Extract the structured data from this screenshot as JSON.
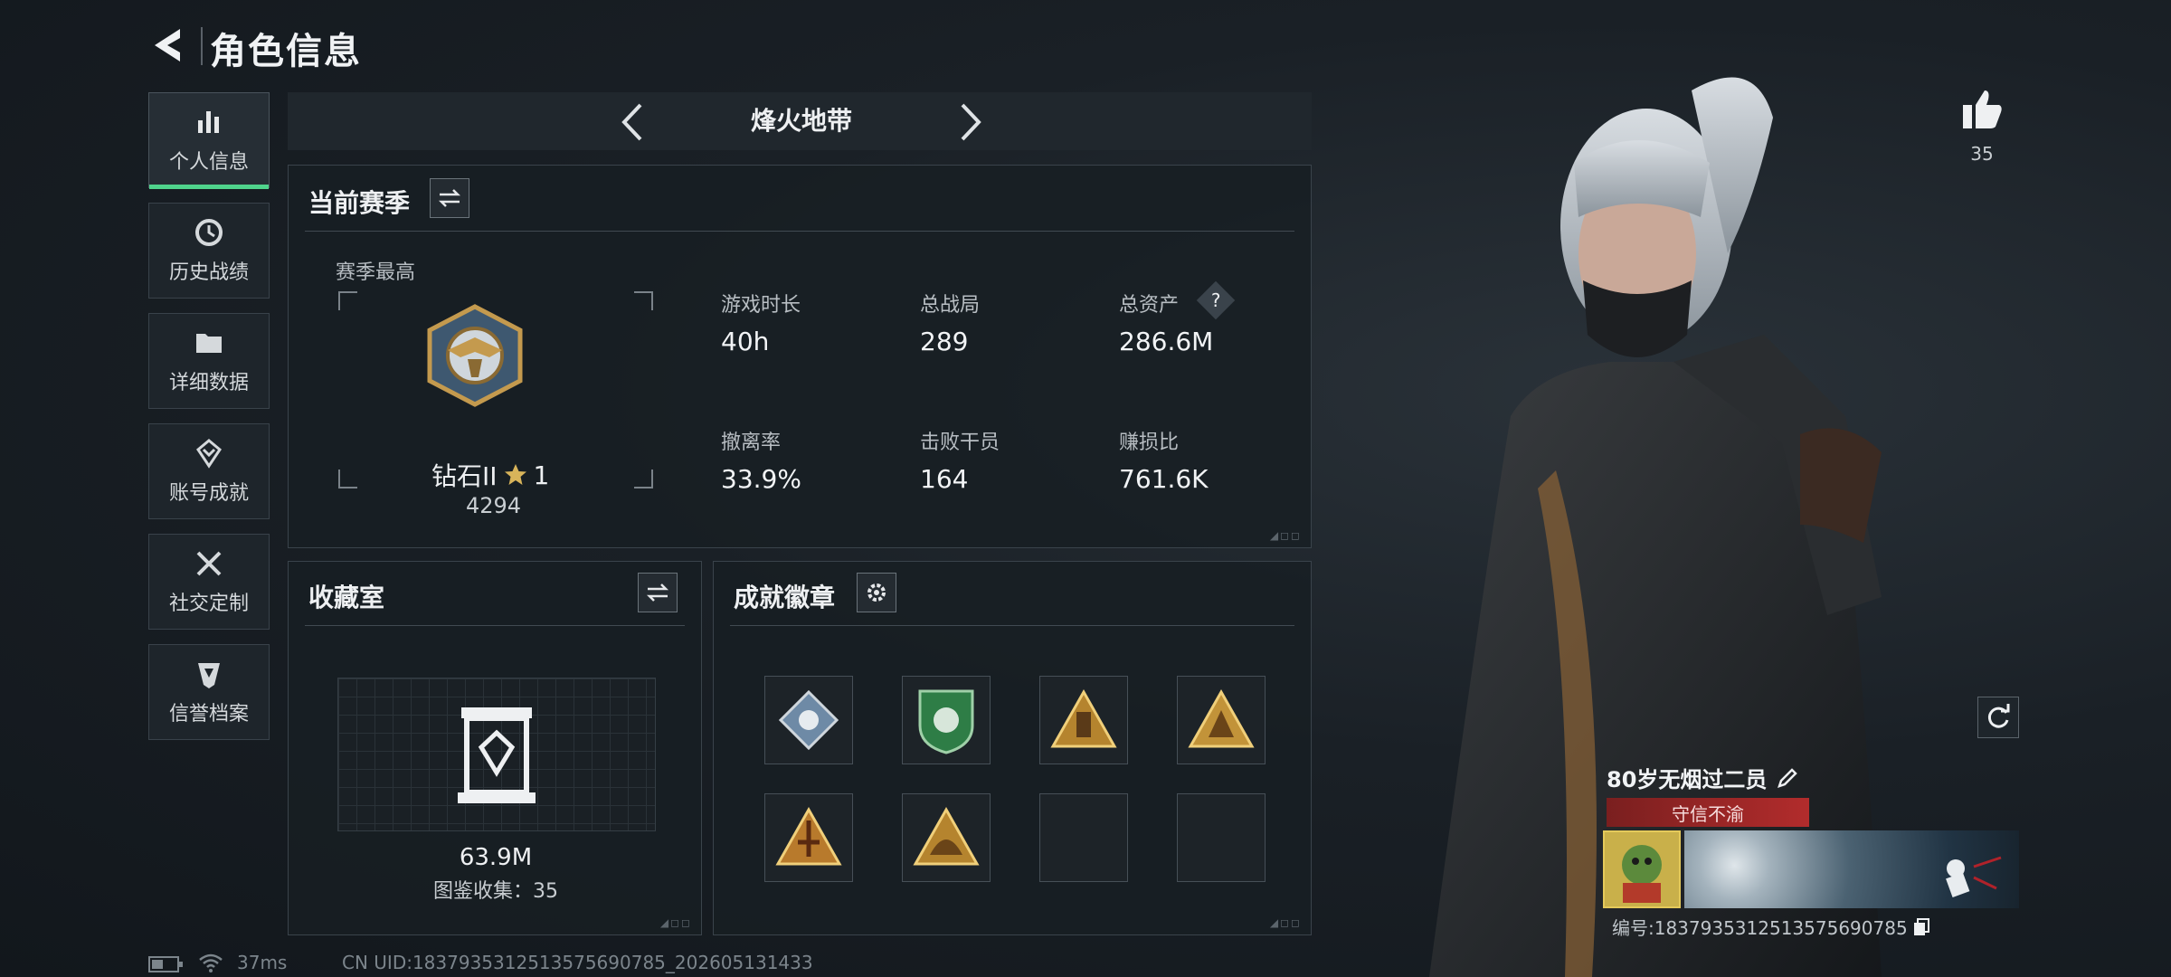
{
  "header": {
    "title": "角色信息"
  },
  "sidebar": {
    "items": [
      {
        "label": "个人信息",
        "icon": "stats-bar-icon",
        "active": true
      },
      {
        "label": "历史战绩",
        "icon": "clock-icon"
      },
      {
        "label": "详细数据",
        "icon": "folder-icon"
      },
      {
        "label": "账号成就",
        "icon": "medal-icon"
      },
      {
        "label": "社交定制",
        "icon": "tools-icon"
      },
      {
        "label": "信誉档案",
        "icon": "shield-icon"
      }
    ]
  },
  "mode_bar": {
    "title": "烽火地带"
  },
  "season": {
    "title": "当前赛季",
    "best_label": "赛季最高",
    "rank_name": "钻石II",
    "rank_stars": "1",
    "rank_points": "4294",
    "stats": [
      {
        "label": "游戏时长",
        "value": "40h"
      },
      {
        "label": "总战局",
        "value": "289"
      },
      {
        "label": "总资产",
        "value": "286.6M"
      },
      {
        "label": "撤离率",
        "value": "33.9%"
      },
      {
        "label": "击败干员",
        "value": "164"
      },
      {
        "label": "赚损比",
        "value": "761.6K"
      }
    ]
  },
  "collection": {
    "title": "收藏室",
    "value": "63.9M",
    "count_label": "图鉴收集：35"
  },
  "achievements": {
    "title": "成就徽章",
    "badges": [
      "badge-1",
      "badge-2",
      "badge-3",
      "badge-4",
      "badge-5",
      "badge-6",
      "",
      ""
    ]
  },
  "profile": {
    "likes": "35",
    "player_name": "80岁无烟过二员",
    "title_text": "守信不渝",
    "player_id": "编号:1837935312513575690785"
  },
  "status": {
    "ping": "37ms",
    "uid": "CN UID:1837935312513575690785_202605131433"
  },
  "colors": {
    "accent": "#4fd48c",
    "banner_red": "#b22c2c"
  }
}
